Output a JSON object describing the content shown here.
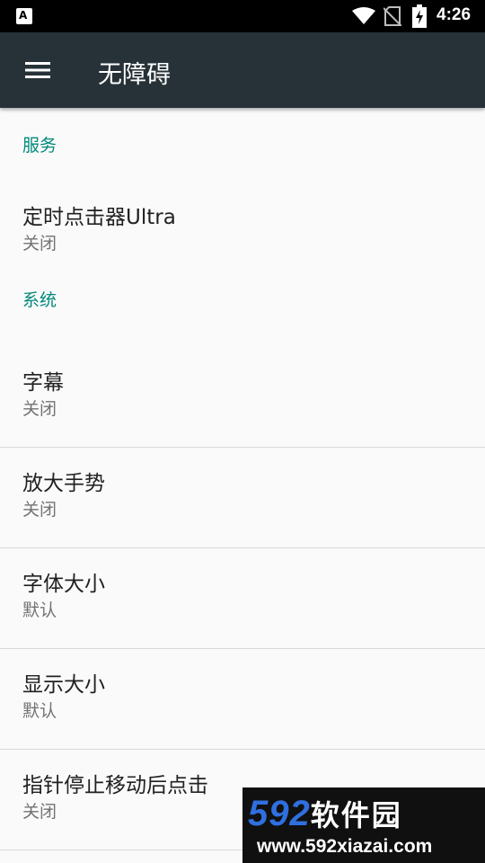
{
  "status_bar": {
    "time": "4:26",
    "notification_icon": "accessibility-app-icon",
    "icons": [
      "wifi-icon",
      "no-sim-icon",
      "battery-charging-icon"
    ]
  },
  "app_bar": {
    "title": "无障碍",
    "menu_icon": "hamburger-menu-icon"
  },
  "sections": [
    {
      "header": "服务",
      "items": [
        {
          "title": "定时点击器Ultra",
          "subtitle": "关闭"
        }
      ]
    },
    {
      "header": "系统",
      "items": [
        {
          "title": "字幕",
          "subtitle": "关闭"
        },
        {
          "title": "放大手势",
          "subtitle": "关闭"
        },
        {
          "title": "字体大小",
          "subtitle": "默认"
        },
        {
          "title": "显示大小",
          "subtitle": "默认"
        },
        {
          "title": "指针停止移动后点击",
          "subtitle": "关闭"
        }
      ]
    }
  ],
  "watermark": {
    "brand_number": "592",
    "brand_text": "软件园",
    "url": "www.592xiazai.com"
  },
  "colors": {
    "app_bar": "#263238",
    "accent": "#00897b",
    "background": "#fafafa"
  }
}
